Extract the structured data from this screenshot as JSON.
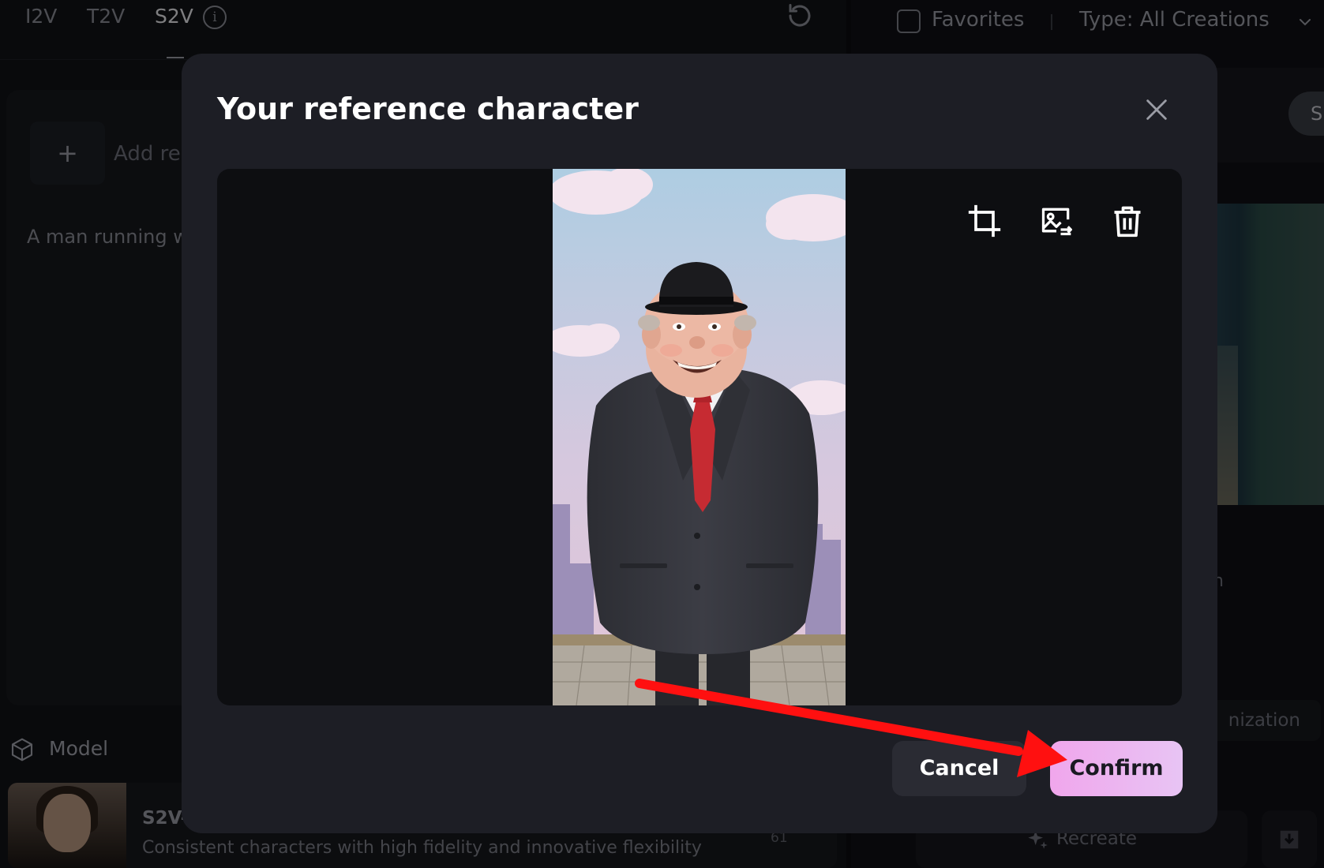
{
  "tabs": [
    {
      "label": "I2V"
    },
    {
      "label": "T2V"
    },
    {
      "label": "S2V",
      "active": true
    }
  ],
  "reference": {
    "add_label": "Add re",
    "add_plus": "+",
    "prompt_text": "A man running w"
  },
  "model": {
    "section_label": "Model",
    "name": "S2V-",
    "description": "Consistent characters with high fidelity and innovative flexibility",
    "count": "61"
  },
  "library": {
    "favorites_label": "Favorites",
    "type_label": "Type:  All Creations",
    "filter_pill": "S",
    "partial_text": "h",
    "option_label": "nization",
    "recreate_label": "Recreate"
  },
  "modal": {
    "title": "Your reference character",
    "cancel_label": "Cancel",
    "confirm_label": "Confirm"
  },
  "colors": {
    "modal_bg": "#1d1e25",
    "confirm_gradient_start": "#f0a6ec",
    "confirm_gradient_end": "#e8c4f4",
    "annotation_arrow": "#ff1010"
  },
  "icons": {
    "close": "close-icon",
    "crop": "crop-icon",
    "replace": "replace-image-icon",
    "delete": "trash-icon",
    "info": "info-icon",
    "reset": "reset-icon"
  }
}
